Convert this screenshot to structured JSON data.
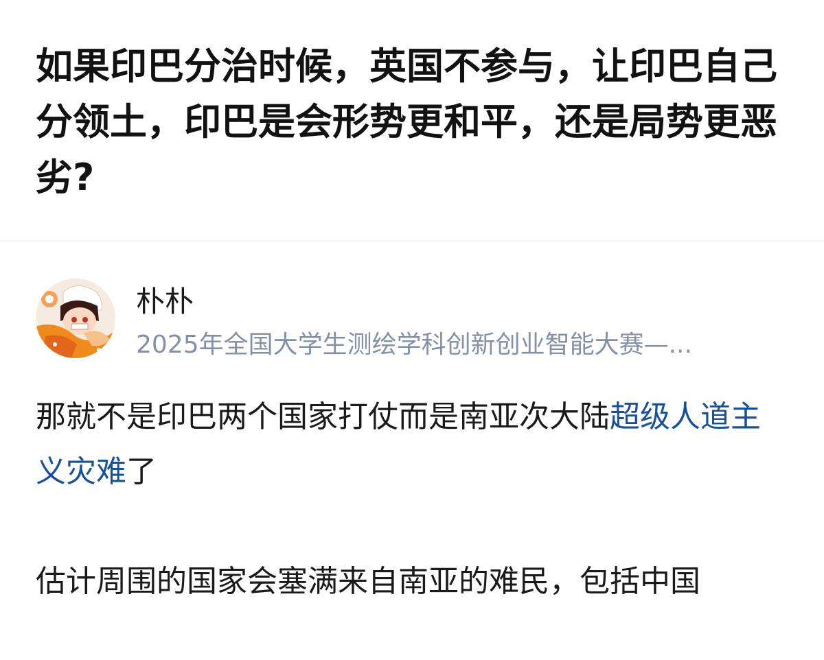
{
  "question": {
    "title": "如果印巴分治时候，英国不参与，让印巴自己分领土，印巴是会形势更和平，还是局势更恶劣?"
  },
  "author": {
    "name": "朴朴",
    "headline": "2025年全国大学生测绘学科创新创业智能大赛—..."
  },
  "answer": {
    "para1_before": "那就不是印巴两个国家打仗而是南亚次大陆",
    "para1_link": "超级人道主义灾难",
    "para1_after": "了",
    "para2": "估计周围的国家会塞满来自南亚的难民，包括中国"
  },
  "colors": {
    "link": "#175199",
    "secondary_text": "#8590a6",
    "primary_text": "#1a1a1a"
  }
}
